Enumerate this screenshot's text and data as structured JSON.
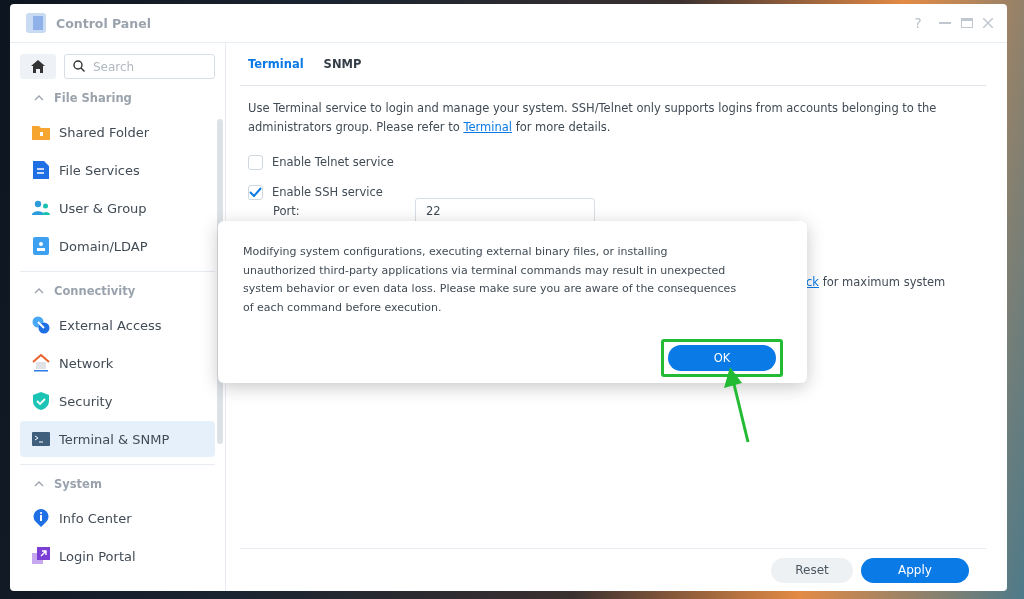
{
  "window": {
    "title": "Control Panel",
    "controls": [
      "?"
    ]
  },
  "sidebar": {
    "search": {
      "placeholder": "Search"
    },
    "groups": [
      {
        "label": "File Sharing",
        "expanded": true,
        "items": [
          {
            "label": "Shared Folder",
            "selected": false
          },
          {
            "label": "File Services",
            "selected": false
          },
          {
            "label": "User & Group",
            "selected": false
          },
          {
            "label": "Domain/LDAP",
            "selected": false
          }
        ]
      },
      {
        "label": "Connectivity",
        "expanded": true,
        "items": [
          {
            "label": "External Access",
            "selected": false
          },
          {
            "label": "Network",
            "selected": false
          },
          {
            "label": "Security",
            "selected": false
          },
          {
            "label": "Terminal & SNMP",
            "selected": true
          }
        ]
      },
      {
        "label": "System",
        "expanded": true,
        "items": [
          {
            "label": "Info Center",
            "selected": false
          },
          {
            "label": "Login Portal",
            "selected": false
          }
        ]
      }
    ]
  },
  "tabs": [
    {
      "label": "Terminal",
      "selected": true
    },
    {
      "label": "SNMP",
      "selected": false
    }
  ],
  "description": {
    "before": "Use Terminal service to login and manage your system. SSH/Telnet only supports logins from accounts belonging to the administrators group. Please refer to",
    "link": "Terminal",
    "after": "for more details."
  },
  "options": [
    {
      "label": "Enable Telnet service",
      "checked": false
    },
    {
      "label": "Enable SSH service",
      "checked": true
    }
  ],
  "port": {
    "label": "Port:",
    "value": "22"
  },
  "hidden_note": {
    "link": "ck",
    "text": "for maximum system"
  },
  "footer_buttons": [
    {
      "label": "Reset",
      "kind": "secondary"
    },
    {
      "label": "Apply",
      "kind": "primary"
    }
  ],
  "dialog": {
    "message": "Modifying system configurations, executing external binary files, or installing unauthorized third-party applications via terminal commands may result in unexpected system behavior or even data loss. Please make sure you are aware of the consequences of each command before execution.",
    "button": "OK",
    "highlighted": true
  }
}
